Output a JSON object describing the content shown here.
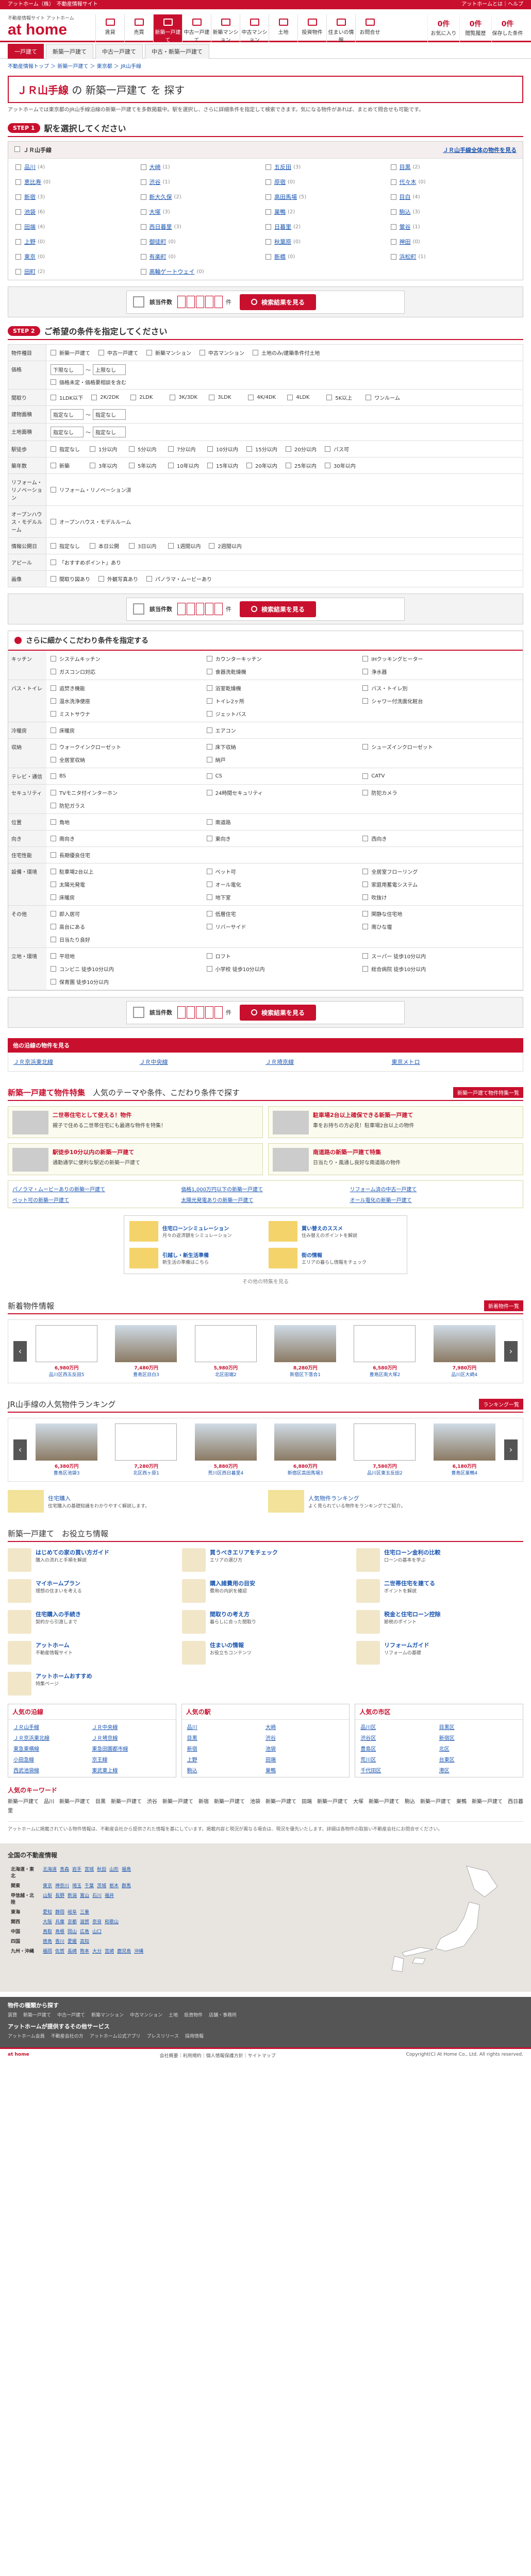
{
  "topstrip": {
    "left": "アットホーム（株）　不動産情報サイト",
    "right": "アットホームとは｜ヘルプ"
  },
  "header": {
    "sub": "不動産情報サイト アットホーム",
    "logo": "at home",
    "gnav": [
      "賃貸",
      "売買",
      "新築一戸建て",
      "中古一戸建て",
      "新築マンション",
      "中古マンション",
      "土地",
      "投資物件",
      "住まいの情報",
      "お問合せ"
    ],
    "right": [
      {
        "n": "0件",
        "l": "お気に入り"
      },
      {
        "n": "0件",
        "l": "閲覧履歴"
      },
      {
        "n": "0件",
        "l": "保存した条件"
      }
    ]
  },
  "subtabs": [
    "一戸建て",
    "新築一戸建て",
    "中古一戸建て",
    "中古・新築一戸建て"
  ],
  "breadcrumb": "不動産情報トップ ＞ 新築一戸建て ＞ 東京都 ＞ JR山手線",
  "title": {
    "pre": "ＪＲ山手線",
    "mid": " の 新築一戸建て を 探す"
  },
  "lead": "アットホームでは東京都のJR山手線沿線の新築一戸建てを多数掲載中。駅を選択し、さらに詳細条件を指定して検索できます。気になる物件があれば、まとめて問合せも可能です。",
  "step1": {
    "badge": "STEP 1",
    "title": "駅を選択してください"
  },
  "line": {
    "name": "ＪＲ山手線",
    "all": "ＪＲ山手線全体の物件を見る"
  },
  "stations": [
    {
      "n": "品川",
      "c": "(4)"
    },
    {
      "n": "大崎",
      "c": "(1)"
    },
    {
      "n": "五反田",
      "c": "(3)"
    },
    {
      "n": "目黒",
      "c": "(2)"
    },
    {
      "n": "恵比寿",
      "c": "(0)"
    },
    {
      "n": "渋谷",
      "c": "(1)"
    },
    {
      "n": "原宿",
      "c": "(0)"
    },
    {
      "n": "代々木",
      "c": "(0)"
    },
    {
      "n": "新宿",
      "c": "(3)"
    },
    {
      "n": "新大久保",
      "c": "(2)"
    },
    {
      "n": "高田馬場",
      "c": "(5)"
    },
    {
      "n": "目白",
      "c": "(4)"
    },
    {
      "n": "池袋",
      "c": "(6)"
    },
    {
      "n": "大塚",
      "c": "(3)"
    },
    {
      "n": "巣鴨",
      "c": "(2)"
    },
    {
      "n": "駒込",
      "c": "(3)"
    },
    {
      "n": "田端",
      "c": "(4)"
    },
    {
      "n": "西日暮里",
      "c": "(3)"
    },
    {
      "n": "日暮里",
      "c": "(2)"
    },
    {
      "n": "鶯谷",
      "c": "(1)"
    },
    {
      "n": "上野",
      "c": "(0)"
    },
    {
      "n": "御徒町",
      "c": "(0)"
    },
    {
      "n": "秋葉原",
      "c": "(0)"
    },
    {
      "n": "神田",
      "c": "(0)"
    },
    {
      "n": "東京",
      "c": "(0)"
    },
    {
      "n": "有楽町",
      "c": "(0)"
    },
    {
      "n": "新橋",
      "c": "(0)"
    },
    {
      "n": "浜松町",
      "c": "(1)"
    },
    {
      "n": "田町",
      "c": "(2)"
    },
    {
      "n": "高輪ゲートウェイ",
      "c": "(0)"
    }
  ],
  "searchbar": {
    "label": "該当件数",
    "unit": "件",
    "button": "検索結果を見る"
  },
  "step2": {
    "badge": "STEP 2",
    "title": "ご希望の条件を指定してください"
  },
  "conditions": [
    {
      "h": "物件種目",
      "opts": [
        "新築一戸建て",
        "中古一戸建て",
        "新築マンション",
        "中古マンション",
        "土地のみ/建築条件付土地"
      ]
    },
    {
      "h": "価格",
      "sel": [
        "下限なし",
        "上限なし"
      ],
      "opts": [
        "価格未定・価格要相談を含む"
      ]
    },
    {
      "h": "間取り",
      "opts": [
        "1LDK以下",
        "2K/2DK",
        "2LDK",
        "3K/3DK",
        "3LDK",
        "4K/4DK",
        "4LDK",
        "5K以上",
        "ワンルーム",
        "",
        ""
      ]
    },
    {
      "h": "建物面積",
      "sel": [
        "指定なし",
        "指定なし"
      ],
      "opts": []
    },
    {
      "h": "土地面積",
      "sel": [
        "指定なし",
        "指定なし"
      ],
      "opts": []
    },
    {
      "h": "駅徒歩",
      "opts": [
        "指定なし",
        "1分以内",
        "5分以内",
        "7分以内",
        "10分以内",
        "15分以内",
        "20分以内",
        "バス可"
      ]
    },
    {
      "h": "築年数",
      "opts": [
        "新築",
        "3年以内",
        "5年以内",
        "10年以内",
        "15年以内",
        "20年以内",
        "25年以内",
        "30年以内"
      ]
    },
    {
      "h": "リフォーム・リノベーション",
      "opts": [
        "リフォーム・リノベーション済"
      ]
    },
    {
      "h": "オープンハウス・モデルルーム",
      "opts": [
        "オープンハウス・モデルルーム"
      ]
    },
    {
      "h": "情報公開日",
      "opts": [
        "指定なし",
        "本日公開",
        "3日以内",
        "1週間以内",
        "2週間以内"
      ]
    },
    {
      "h": "アピール",
      "opts": [
        "「おすすめポイント」あり"
      ]
    },
    {
      "h": "画像",
      "opts": [
        "間取り図あり",
        "外観写真あり",
        "パノラマ・ムービーあり"
      ]
    }
  ],
  "kodawari": {
    "title": "さらに細かくこだわり条件を指定する",
    "rows": [
      {
        "h": "キッチン",
        "opts": [
          "システムキッチン",
          "カウンターキッチン",
          "IHクッキングヒーター",
          "ガスコンロ対応",
          "食器洗乾燥機",
          "浄水器"
        ]
      },
      {
        "h": "バス・トイレ",
        "opts": [
          "追焚き機能",
          "浴室乾燥機",
          "バス・トイレ別",
          "温水洗浄便座",
          "トイレ2ヶ所",
          "シャワー付洗面化粧台",
          "ミストサウナ",
          "ジェットバス"
        ]
      },
      {
        "h": "冷暖房",
        "opts": [
          "床暖房",
          "エアコン"
        ]
      },
      {
        "h": "収納",
        "opts": [
          "ウォークインクローゼット",
          "床下収納",
          "シューズインクローゼット",
          "全居室収納",
          "納戸"
        ]
      },
      {
        "h": "テレビ・通信",
        "opts": [
          "BS",
          "CS",
          "CATV"
        ]
      },
      {
        "h": "セキュリティ",
        "opts": [
          "TVモニタ付インターホン",
          "24時間セキュリティ",
          "防犯カメラ",
          "防犯ガラス"
        ]
      },
      {
        "h": "位置",
        "opts": [
          "角地",
          "南道路"
        ]
      },
      {
        "h": "向き",
        "opts": [
          "南向き",
          "東向き",
          "西向き"
        ]
      },
      {
        "h": "住宅性能",
        "opts": [
          "長期優良住宅"
        ]
      },
      {
        "h": "設備・環境",
        "opts": [
          "駐車場2台以上",
          "ペット可",
          "全居室フローリング",
          "太陽光発電",
          "オール電化",
          "家庭用蓄電システム",
          "床暖房",
          "地下室",
          "吹抜け"
        ]
      },
      {
        "h": "その他",
        "opts": [
          "即入居可",
          "低層住宅",
          "閑静な住宅地",
          "高台にある",
          "リバーサイド",
          "南ひな壇",
          "日当たり良好"
        ]
      },
      {
        "h": "立地・環境",
        "opts": [
          "平坦地",
          "ロフト",
          "スーパー 徒歩10分以内",
          "コンビニ 徒歩10分以内",
          "小学校 徒歩10分以内",
          "総合病院 徒歩10分以内",
          "保育園 徒歩10分以内"
        ]
      }
    ]
  },
  "otherlines": {
    "title": "他の沿線の物件を見る",
    "items": [
      "ＪＲ京浜東北線",
      "ＪＲ中央線",
      "ＪＲ埼京線",
      "東京メトロ"
    ]
  },
  "features": {
    "title_pre": "新築一戸建て物件特集",
    "title_post": "人気のテーマや条件、こだわり条件で探す",
    "more": "新築一戸建て物件特集一覧",
    "items": [
      {
        "t": "二世帯住宅として使える！物件",
        "d": "親子で住める二世帯住宅にも最適な物件を特集！"
      },
      {
        "t": "駐車場2台以上確保できる新築一戸建て",
        "d": "車をお持ちの方必見！駐車場2台以上の物件"
      },
      {
        "t": "駅徒歩10分以内の新築一戸建て",
        "d": "通勤通学に便利な駅近の新築一戸建て"
      },
      {
        "t": "南道路の新築一戸建て特集",
        "d": "日当たり・風通し良好な南道路の物件"
      }
    ],
    "links": [
      "パノラマ・ムービーありの新築一戸建て",
      "価格1,000万円以下の新築一戸建て",
      "リフォーム済の中古一戸建て",
      "ペット可の新築一戸建て",
      "太陽光発電ありの新築一戸建て",
      "オール電化の新築一戸建て"
    ]
  },
  "promo": {
    "items": [
      {
        "t": "住宅ローンシミュレーション",
        "d": "月々の返済額をシミュレーション"
      },
      {
        "t": "買い替えのススメ",
        "d": "住み替えのポイントを解説"
      },
      {
        "t": "引越し・新生活準備",
        "d": "新生活の準備はこちら"
      },
      {
        "t": "街の情報",
        "d": "エリアの暮らし情報をチェック"
      }
    ],
    "more": "その他の特集を見る"
  },
  "newlist": {
    "title": "新着物件情報",
    "more": "新着物件一覧",
    "cards": [
      {
        "price": "6,980万円",
        "name": "品川区西五反田5"
      },
      {
        "price": "7,480万円",
        "name": "豊島区目白3"
      },
      {
        "price": "5,980万円",
        "name": "北区田端2"
      },
      {
        "price": "8,280万円",
        "name": "新宿区下落合1"
      },
      {
        "price": "6,580万円",
        "name": "豊島区南大塚2"
      },
      {
        "price": "7,980万円",
        "name": "品川区大崎4"
      }
    ]
  },
  "ranking": {
    "title": "JR山手線の人気物件ランキング",
    "more": "ランキング一覧",
    "cards": [
      {
        "price": "6,380万円",
        "name": "豊島区池袋3"
      },
      {
        "price": "7,280万円",
        "name": "北区西ヶ原1"
      },
      {
        "price": "5,880万円",
        "name": "荒川区西日暮里4"
      },
      {
        "price": "6,880万円",
        "name": "新宿区高田馬場3"
      },
      {
        "price": "7,580万円",
        "name": "品川区東五反田2"
      },
      {
        "price": "6,180万円",
        "name": "豊島区巣鴨4"
      }
    ]
  },
  "rankban": [
    {
      "t": "住宅購入",
      "d": "住宅購入の基礎知識をわかりやすく解説します。"
    },
    {
      "t": "人気物件ランキング",
      "d": "よく見られている物件をランキングでご紹介。"
    }
  ],
  "useful": {
    "title": "新築一戸建て　お役立ち情報",
    "items": [
      {
        "t": "はじめての家の買い方ガイド",
        "d": "購入の流れと手順を解説"
      },
      {
        "t": "買うべきエリアをチェック",
        "d": "エリアの選び方"
      },
      {
        "t": "住宅ローン金利の比較",
        "d": "ローンの基本を学ぶ"
      },
      {
        "t": "マイホームプラン",
        "d": "理想の住まいを考える"
      },
      {
        "t": "購入諸費用の目安",
        "d": "費用の内訳を確認"
      },
      {
        "t": "二世帯住宅を建てる",
        "d": "ポイントを解説"
      },
      {
        "t": "住宅購入の手続き",
        "d": "契約から引渡しまで"
      },
      {
        "t": "間取りの考え方",
        "d": "暮らしに合った間取り"
      },
      {
        "t": "税金と住宅ローン控除",
        "d": "節税のポイント"
      },
      {
        "t": "アットホーム",
        "d": "不動産情報サイト"
      },
      {
        "t": "住まいの情報",
        "d": "お役立ちコンテンツ"
      },
      {
        "t": "リフォームガイド",
        "d": "リフォームの基礎"
      },
      {
        "t": "アットホームおすすめ",
        "d": "特集ページ"
      }
    ]
  },
  "popular": [
    {
      "h": "人気の沿線",
      "items": [
        "ＪＲ山手線",
        "ＪＲ中央線",
        "ＪＲ京浜東北線",
        "ＪＲ埼京線",
        "東急東横線",
        "東急田園都市線",
        "小田急線",
        "京王線",
        "西武池袋線",
        "東武東上線"
      ]
    },
    {
      "h": "人気の駅",
      "items": [
        "品川",
        "大崎",
        "目黒",
        "渋谷",
        "新宿",
        "池袋",
        "上野",
        "田端",
        "駒込",
        "巣鴨"
      ]
    },
    {
      "h": "人気の市区",
      "items": [
        "品川区",
        "目黒区",
        "渋谷区",
        "新宿区",
        "豊島区",
        "北区",
        "荒川区",
        "台東区",
        "千代田区",
        "港区"
      ]
    }
  ],
  "keywords": {
    "title": "人気のキーワード",
    "text": "新築一戸建て　品川　新築一戸建て　目黒　新築一戸建て　渋谷　新築一戸建て　新宿　新築一戸建て　池袋　新築一戸建て　田端　新築一戸建て　大塚　新築一戸建て　駒込　新築一戸建て　巣鴨　新築一戸建て　西日暮里"
  },
  "disclaimer": "アットホームに掲載されている物件情報は、不動産会社から提供された情報を基にしています。掲載内容と現況が異なる場合は、現況を優先いたします。詳細は各物件の取扱い不動産会社にお問合せください。",
  "area": {
    "title": "全国の不動産情報",
    "rows": [
      {
        "r": "北海道・東北",
        "p": [
          "北海道",
          "青森",
          "岩手",
          "宮城",
          "秋田",
          "山形",
          "福島"
        ]
      },
      {
        "r": "関東",
        "p": [
          "東京",
          "神奈川",
          "埼玉",
          "千葉",
          "茨城",
          "栃木",
          "群馬"
        ]
      },
      {
        "r": "甲信越・北陸",
        "p": [
          "山梨",
          "長野",
          "新潟",
          "富山",
          "石川",
          "福井"
        ]
      },
      {
        "r": "東海",
        "p": [
          "愛知",
          "静岡",
          "岐阜",
          "三重"
        ]
      },
      {
        "r": "関西",
        "p": [
          "大阪",
          "兵庫",
          "京都",
          "滋賀",
          "奈良",
          "和歌山"
        ]
      },
      {
        "r": "中国",
        "p": [
          "鳥取",
          "島根",
          "岡山",
          "広島",
          "山口"
        ]
      },
      {
        "r": "四国",
        "p": [
          "徳島",
          "香川",
          "愛媛",
          "高知"
        ]
      },
      {
        "r": "九州・沖縄",
        "p": [
          "福岡",
          "佐賀",
          "長崎",
          "熊本",
          "大分",
          "宮崎",
          "鹿児島",
          "沖縄"
        ]
      }
    ]
  },
  "footdark": [
    {
      "h": "物件の種類から探す",
      "l": [
        "賃貸",
        "新築一戸建て",
        "中古一戸建て",
        "新築マンション",
        "中古マンション",
        "土地",
        "投資物件",
        "店舗・事務所"
      ]
    },
    {
      "h": "アットホームが提供するその他サービス",
      "l": [
        "アットホーム会員",
        "不動産会社の方",
        "アットホーム公式アプリ",
        "プレスリリース",
        "採用情報"
      ]
    }
  ],
  "copyright": "Copyright(C) At Home Co., Ltd. All rights reserved.",
  "footlinks": "会社概要｜利用規約｜個人情報保護方針｜サイトマップ"
}
